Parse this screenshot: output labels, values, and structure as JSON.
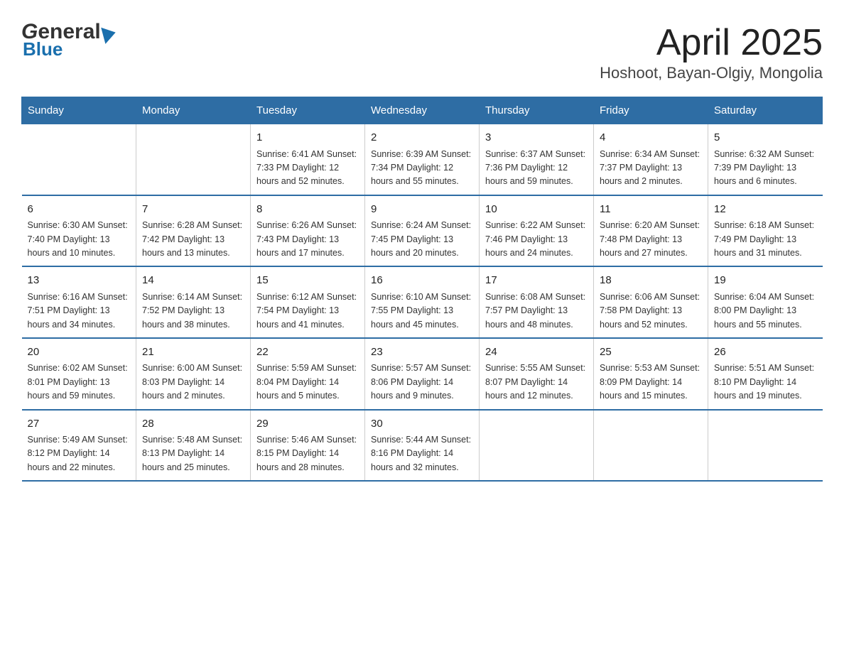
{
  "header": {
    "logo_line1": "General",
    "logo_line2": "Blue",
    "title": "April 2025",
    "subtitle": "Hoshoot, Bayan-Olgiy, Mongolia"
  },
  "days_of_week": [
    "Sunday",
    "Monday",
    "Tuesday",
    "Wednesday",
    "Thursday",
    "Friday",
    "Saturday"
  ],
  "weeks": [
    [
      {
        "day": "",
        "info": ""
      },
      {
        "day": "",
        "info": ""
      },
      {
        "day": "1",
        "info": "Sunrise: 6:41 AM\nSunset: 7:33 PM\nDaylight: 12 hours\nand 52 minutes."
      },
      {
        "day": "2",
        "info": "Sunrise: 6:39 AM\nSunset: 7:34 PM\nDaylight: 12 hours\nand 55 minutes."
      },
      {
        "day": "3",
        "info": "Sunrise: 6:37 AM\nSunset: 7:36 PM\nDaylight: 12 hours\nand 59 minutes."
      },
      {
        "day": "4",
        "info": "Sunrise: 6:34 AM\nSunset: 7:37 PM\nDaylight: 13 hours\nand 2 minutes."
      },
      {
        "day": "5",
        "info": "Sunrise: 6:32 AM\nSunset: 7:39 PM\nDaylight: 13 hours\nand 6 minutes."
      }
    ],
    [
      {
        "day": "6",
        "info": "Sunrise: 6:30 AM\nSunset: 7:40 PM\nDaylight: 13 hours\nand 10 minutes."
      },
      {
        "day": "7",
        "info": "Sunrise: 6:28 AM\nSunset: 7:42 PM\nDaylight: 13 hours\nand 13 minutes."
      },
      {
        "day": "8",
        "info": "Sunrise: 6:26 AM\nSunset: 7:43 PM\nDaylight: 13 hours\nand 17 minutes."
      },
      {
        "day": "9",
        "info": "Sunrise: 6:24 AM\nSunset: 7:45 PM\nDaylight: 13 hours\nand 20 minutes."
      },
      {
        "day": "10",
        "info": "Sunrise: 6:22 AM\nSunset: 7:46 PM\nDaylight: 13 hours\nand 24 minutes."
      },
      {
        "day": "11",
        "info": "Sunrise: 6:20 AM\nSunset: 7:48 PM\nDaylight: 13 hours\nand 27 minutes."
      },
      {
        "day": "12",
        "info": "Sunrise: 6:18 AM\nSunset: 7:49 PM\nDaylight: 13 hours\nand 31 minutes."
      }
    ],
    [
      {
        "day": "13",
        "info": "Sunrise: 6:16 AM\nSunset: 7:51 PM\nDaylight: 13 hours\nand 34 minutes."
      },
      {
        "day": "14",
        "info": "Sunrise: 6:14 AM\nSunset: 7:52 PM\nDaylight: 13 hours\nand 38 minutes."
      },
      {
        "day": "15",
        "info": "Sunrise: 6:12 AM\nSunset: 7:54 PM\nDaylight: 13 hours\nand 41 minutes."
      },
      {
        "day": "16",
        "info": "Sunrise: 6:10 AM\nSunset: 7:55 PM\nDaylight: 13 hours\nand 45 minutes."
      },
      {
        "day": "17",
        "info": "Sunrise: 6:08 AM\nSunset: 7:57 PM\nDaylight: 13 hours\nand 48 minutes."
      },
      {
        "day": "18",
        "info": "Sunrise: 6:06 AM\nSunset: 7:58 PM\nDaylight: 13 hours\nand 52 minutes."
      },
      {
        "day": "19",
        "info": "Sunrise: 6:04 AM\nSunset: 8:00 PM\nDaylight: 13 hours\nand 55 minutes."
      }
    ],
    [
      {
        "day": "20",
        "info": "Sunrise: 6:02 AM\nSunset: 8:01 PM\nDaylight: 13 hours\nand 59 minutes."
      },
      {
        "day": "21",
        "info": "Sunrise: 6:00 AM\nSunset: 8:03 PM\nDaylight: 14 hours\nand 2 minutes."
      },
      {
        "day": "22",
        "info": "Sunrise: 5:59 AM\nSunset: 8:04 PM\nDaylight: 14 hours\nand 5 minutes."
      },
      {
        "day": "23",
        "info": "Sunrise: 5:57 AM\nSunset: 8:06 PM\nDaylight: 14 hours\nand 9 minutes."
      },
      {
        "day": "24",
        "info": "Sunrise: 5:55 AM\nSunset: 8:07 PM\nDaylight: 14 hours\nand 12 minutes."
      },
      {
        "day": "25",
        "info": "Sunrise: 5:53 AM\nSunset: 8:09 PM\nDaylight: 14 hours\nand 15 minutes."
      },
      {
        "day": "26",
        "info": "Sunrise: 5:51 AM\nSunset: 8:10 PM\nDaylight: 14 hours\nand 19 minutes."
      }
    ],
    [
      {
        "day": "27",
        "info": "Sunrise: 5:49 AM\nSunset: 8:12 PM\nDaylight: 14 hours\nand 22 minutes."
      },
      {
        "day": "28",
        "info": "Sunrise: 5:48 AM\nSunset: 8:13 PM\nDaylight: 14 hours\nand 25 minutes."
      },
      {
        "day": "29",
        "info": "Sunrise: 5:46 AM\nSunset: 8:15 PM\nDaylight: 14 hours\nand 28 minutes."
      },
      {
        "day": "30",
        "info": "Sunrise: 5:44 AM\nSunset: 8:16 PM\nDaylight: 14 hours\nand 32 minutes."
      },
      {
        "day": "",
        "info": ""
      },
      {
        "day": "",
        "info": ""
      },
      {
        "day": "",
        "info": ""
      }
    ]
  ]
}
